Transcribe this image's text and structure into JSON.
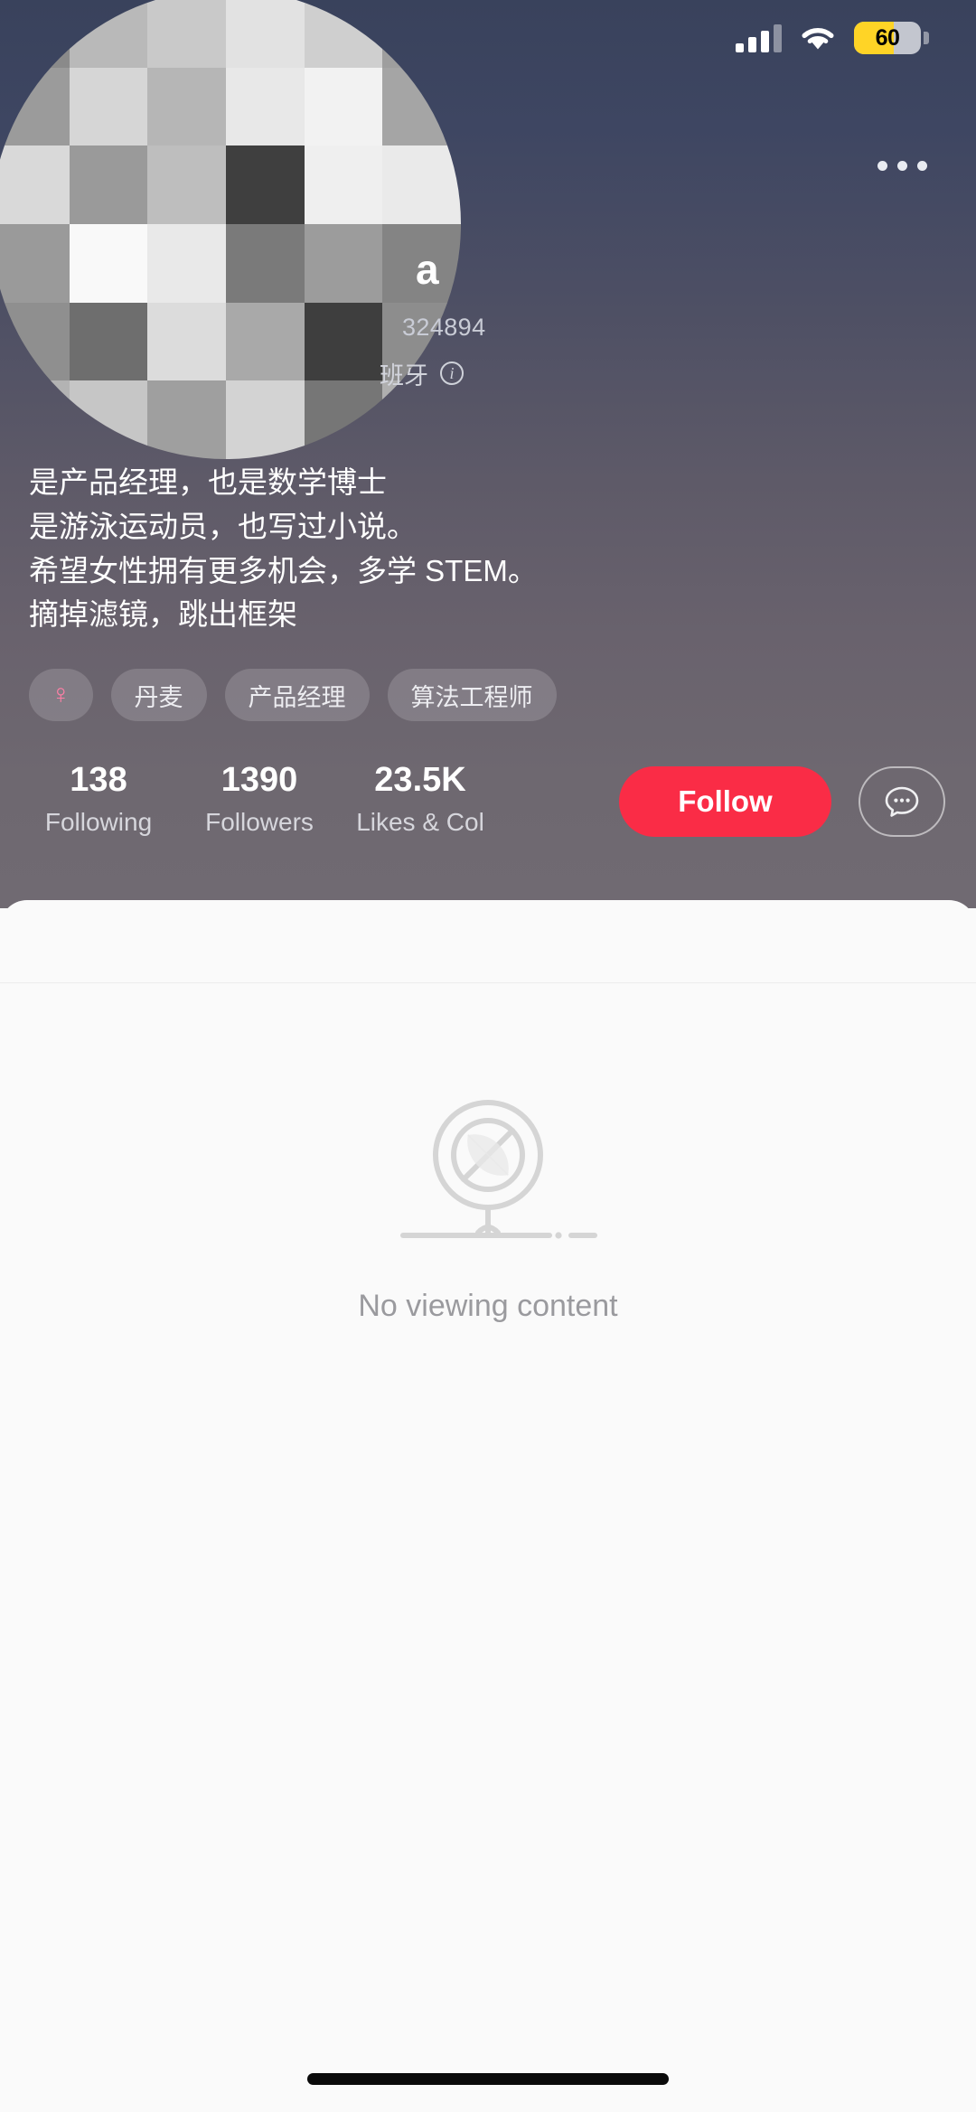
{
  "statusbar": {
    "battery_percent": "60",
    "battery_level": 60,
    "battery_color": "#FFD426",
    "cellular_icon": "cellular-signal-icon",
    "wifi_icon": "wifi-icon"
  },
  "header": {
    "more_icon": "more-options-icon",
    "gradient_top": "#39425C",
    "gradient_bottom": "#706A72",
    "avatar_label": "avatar-censored-mosaic"
  },
  "profile": {
    "username": "a",
    "user_id": "324894",
    "location": "班牙",
    "info_icon": "info-icon",
    "bio_lines": [
      "是产品经理，也是数学博士",
      "是游泳运动员，也写过小说。",
      "希望女性拥有更多机会，多学 STEM。",
      "摘掉滤镜，跳出框架"
    ],
    "tags": [
      {
        "name": "gender-tag",
        "label": "♀"
      },
      {
        "name": "country-tag",
        "label": "丹麦"
      },
      {
        "name": "job-tag",
        "label": "产品经理"
      },
      {
        "name": "role-tag",
        "label": "算法工程师"
      }
    ]
  },
  "stats": [
    {
      "name": "following",
      "value": "138",
      "label": "Following"
    },
    {
      "name": "followers",
      "value": "1390",
      "label": "Followers"
    },
    {
      "name": "likes",
      "value": "23.5K",
      "label": "Likes & Col"
    }
  ],
  "actions": {
    "follow_label": "Follow",
    "follow_color": "#FA2C46",
    "message_icon": "chat-bubble-icon"
  },
  "content": {
    "empty_icon": "no-content-prohibited-icon",
    "empty_text": "No viewing content"
  }
}
